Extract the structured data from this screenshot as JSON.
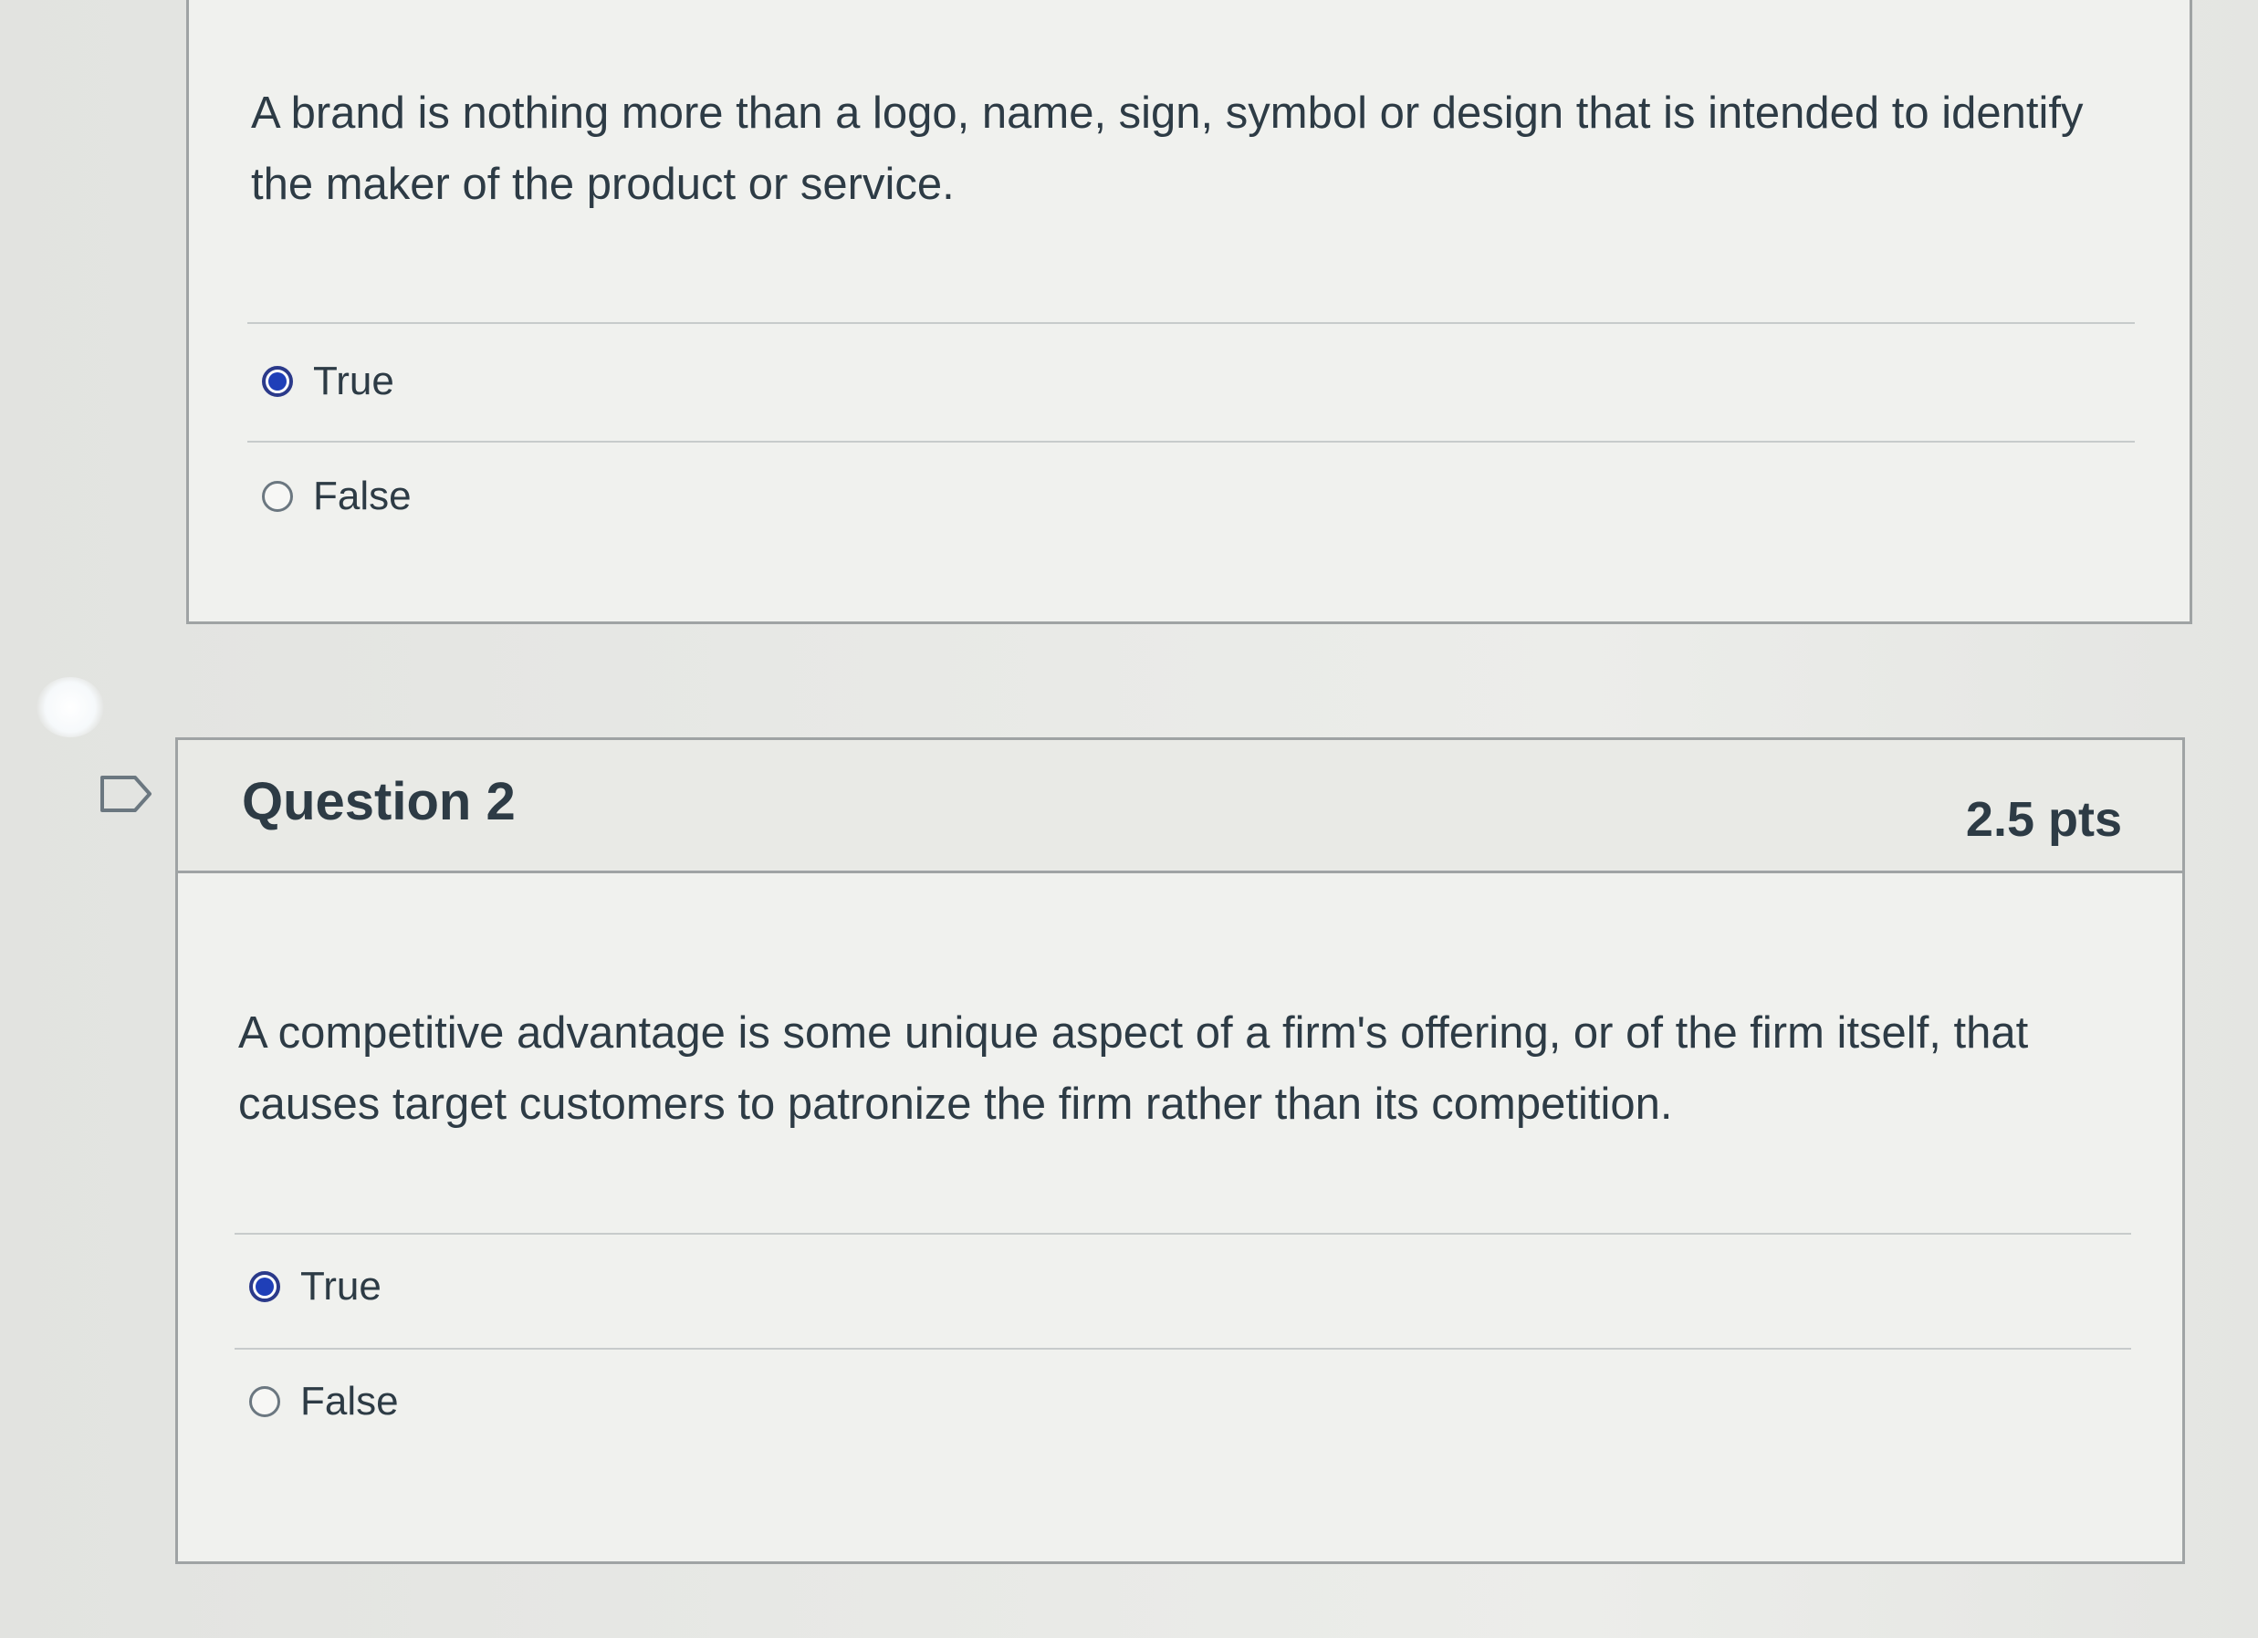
{
  "question_1": {
    "text": "A brand is nothing more than a logo, name, sign, symbol or design that is intended to identify the maker of the product or service.",
    "answers": [
      {
        "label": "True",
        "selected": true
      },
      {
        "label": "False",
        "selected": false
      }
    ]
  },
  "question_2": {
    "title": "Question 2",
    "points": "2.5 pts",
    "text": "A competitive advantage is some unique aspect of a firm's offering, or of the firm itself, that causes target customers to patronize the firm rather than its competition.",
    "answers": [
      {
        "label": "True",
        "selected": true
      },
      {
        "label": "False",
        "selected": false
      }
    ]
  },
  "icons": {
    "flag": "flag-question-icon"
  },
  "colors": {
    "accent": "#1f3fb8",
    "text": "#2d3b45",
    "border": "#9fa3a4"
  }
}
